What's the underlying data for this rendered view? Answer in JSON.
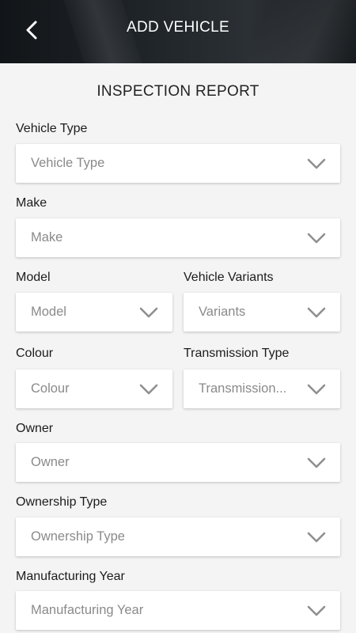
{
  "header": {
    "title": "ADD VEHICLE"
  },
  "page": {
    "title": "INSPECTION REPORT"
  },
  "fields": {
    "vehicle_type": {
      "label": "Vehicle Type",
      "value": "Vehicle Type"
    },
    "make": {
      "label": "Make",
      "value": "Make"
    },
    "model": {
      "label": "Model",
      "value": "Model"
    },
    "variants": {
      "label": "Vehicle Variants",
      "value": "Variants"
    },
    "colour": {
      "label": "Colour",
      "value": "Colour"
    },
    "transmission": {
      "label": "Transmission Type",
      "value": "Transmission..."
    },
    "owner": {
      "label": "Owner",
      "value": "Owner"
    },
    "ownership_type": {
      "label": "Ownership Type",
      "value": "Ownership Type"
    },
    "manufacturing_year": {
      "label": "Manufacturing Year",
      "value": "Manufacturing Year"
    }
  },
  "icons": {
    "back": "chevron-left-icon",
    "dropdown": "chevron-down-icon"
  },
  "colors": {
    "header_bg": "#1f2428",
    "page_bg": "#f4f4f4",
    "placeholder": "#8a8a8a"
  }
}
